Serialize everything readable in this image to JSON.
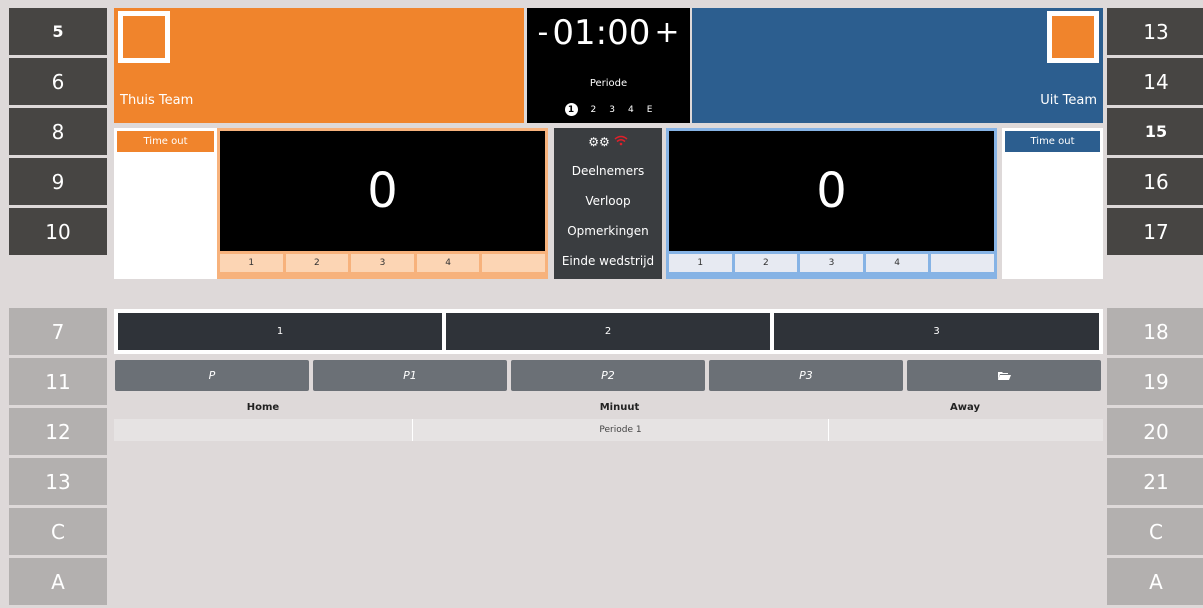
{
  "left_players": [
    {
      "label": "5",
      "style": "dark",
      "bold": true
    },
    {
      "label": "6",
      "style": "dark"
    },
    {
      "label": "8",
      "style": "dark"
    },
    {
      "label": "9",
      "style": "dark"
    },
    {
      "label": "10",
      "style": "dark"
    },
    {
      "label": "",
      "style": "gap"
    },
    {
      "label": "7",
      "style": "light"
    },
    {
      "label": "11",
      "style": "light"
    },
    {
      "label": "12",
      "style": "light"
    },
    {
      "label": "13",
      "style": "light"
    },
    {
      "label": "C",
      "style": "light"
    },
    {
      "label": "A",
      "style": "light"
    }
  ],
  "right_players": [
    {
      "label": "13",
      "style": "dark"
    },
    {
      "label": "14",
      "style": "dark"
    },
    {
      "label": "15",
      "style": "dark",
      "bold": true
    },
    {
      "label": "16",
      "style": "dark"
    },
    {
      "label": "17",
      "style": "dark"
    },
    {
      "label": "",
      "style": "gap"
    },
    {
      "label": "18",
      "style": "light"
    },
    {
      "label": "19",
      "style": "light"
    },
    {
      "label": "20",
      "style": "light"
    },
    {
      "label": "21",
      "style": "light"
    },
    {
      "label": "C",
      "style": "light"
    },
    {
      "label": "A",
      "style": "light"
    }
  ],
  "home": {
    "name": "Thuis Team",
    "score": "0",
    "timeout": "Time out",
    "quarters": [
      "1",
      "2",
      "3",
      "4",
      ""
    ]
  },
  "away": {
    "name": "Uit Team",
    "score": "0",
    "timeout": "Time out",
    "quarters": [
      "1",
      "2",
      "3",
      "4",
      ""
    ]
  },
  "clock": {
    "minus": "-",
    "time": "01:00",
    "plus": "+",
    "label": "Periode",
    "periods": [
      "1",
      "2",
      "3",
      "4",
      "E"
    ],
    "active_period": "1"
  },
  "menu": {
    "items": [
      "Deelnemers",
      "Verloop",
      "Opmerkingen",
      "Einde wedstrijd"
    ]
  },
  "period_buttons": [
    "1",
    "2",
    "3"
  ],
  "tabs": [
    "P",
    "P1",
    "P2",
    "P3"
  ],
  "log": {
    "headers": [
      "Home",
      "Minuut",
      "Away"
    ],
    "rows": [
      [
        "",
        "Periode 1",
        ""
      ]
    ]
  },
  "colors": {
    "home": "#f0842c",
    "away": "#2c5e8f",
    "background": "#ded9d9"
  }
}
